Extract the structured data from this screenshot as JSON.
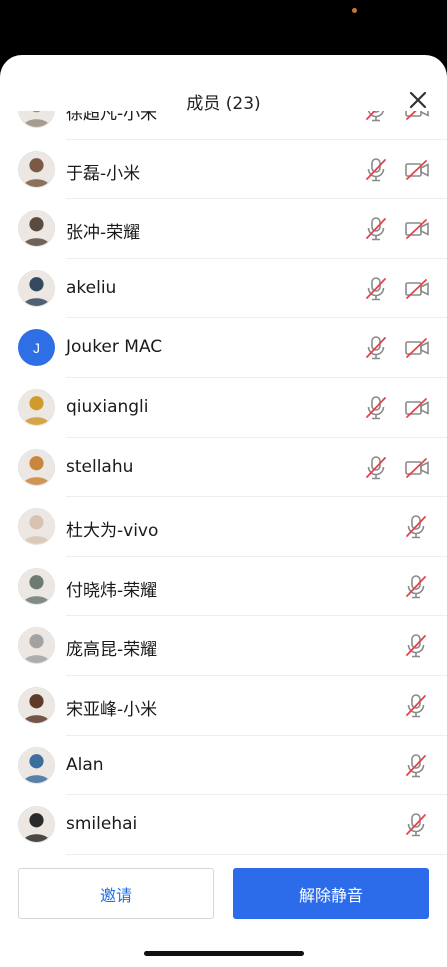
{
  "header": {
    "title": "成员 (23)"
  },
  "members": [
    {
      "name": "徐超凡-小米",
      "avatar": "photo",
      "tone": "#9a8d80",
      "mic": "muted",
      "cam": "off"
    },
    {
      "name": "于磊-小米",
      "avatar": "photo",
      "tone": "#7a5a44",
      "mic": "muted",
      "cam": "off"
    },
    {
      "name": "张冲-荣耀",
      "avatar": "photo",
      "tone": "#5b4a3e",
      "mic": "muted",
      "cam": "off"
    },
    {
      "name": "akeliu",
      "avatar": "photo",
      "tone": "#34495e",
      "mic": "muted",
      "cam": "off"
    },
    {
      "name": "Jouker MAC",
      "avatar": "initial",
      "initial": "J",
      "tone": "#2f6fe6",
      "mic": "muted",
      "cam": "off"
    },
    {
      "name": "qiuxiangli",
      "avatar": "photo",
      "tone": "#d19a2c",
      "mic": "muted",
      "cam": "off"
    },
    {
      "name": "stellahu",
      "avatar": "photo",
      "tone": "#c9863e",
      "mic": "muted",
      "cam": "off"
    },
    {
      "name": "杜大为-vivo",
      "avatar": "photo",
      "tone": "#d8c3b3",
      "mic": "muted",
      "cam": "none"
    },
    {
      "name": "付晓炜-荣耀",
      "avatar": "photo",
      "tone": "#6d7a74",
      "mic": "muted",
      "cam": "none"
    },
    {
      "name": "庞高昆-荣耀",
      "avatar": "photo",
      "tone": "#a2a2a2",
      "mic": "muted",
      "cam": "none"
    },
    {
      "name": "宋亚峰-小米",
      "avatar": "photo",
      "tone": "#5e3a2a",
      "mic": "muted",
      "cam": "none"
    },
    {
      "name": "Alan",
      "avatar": "photo",
      "tone": "#3c6e9e",
      "mic": "muted",
      "cam": "none"
    },
    {
      "name": "smilehai",
      "avatar": "photo",
      "tone": "#2b2b2b",
      "mic": "muted",
      "cam": "none"
    }
  ],
  "footer": {
    "invite_label": "邀请",
    "unmute_all_label": "解除静音"
  },
  "colors": {
    "accent": "#2c6bea",
    "muted_red": "#e0474c",
    "icon_gray": "#8a8a8a"
  },
  "icons": {
    "close": "close-icon",
    "mic": "microphone-muted-icon",
    "cam": "camera-off-icon"
  }
}
